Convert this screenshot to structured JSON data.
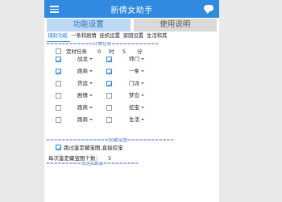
{
  "app": {
    "title": "新倩女助手"
  },
  "main_tabs": [
    {
      "label": "功能设置"
    },
    {
      "label": "使用说明"
    }
  ],
  "sub_tabs": [
    {
      "label": "辅助功能"
    },
    {
      "label": "一条和剧情"
    },
    {
      "label": "挂机设置"
    },
    {
      "label": "家园设置"
    },
    {
      "label": "生活和其"
    }
  ],
  "daily": {
    "header": "============日常任务============",
    "timed_task": {
      "checked": false,
      "label": "定时任务",
      "hour": "0",
      "hour_unit": "时",
      "minute": "5",
      "minute_unit": "分"
    },
    "rows": [
      {
        "left": {
          "checked": true,
          "value": "战龙"
        },
        "right": {
          "checked": true,
          "value": "师门"
        }
      },
      {
        "left": {
          "checked": true,
          "value": "跑商"
        },
        "right": {
          "checked": true,
          "value": "一条"
        }
      },
      {
        "left": {
          "checked": false,
          "value": "货运"
        },
        "right": {
          "checked": true,
          "value": "门派"
        }
      },
      {
        "left": {
          "checked": false,
          "value": "剧情"
        },
        "right": {
          "checked": false,
          "value": "梦岛"
        }
      },
      {
        "left": {
          "checked": false,
          "value": "跑商"
        },
        "right": {
          "checked": false,
          "value": "挖宝"
        }
      },
      {
        "left": {
          "checked": false,
          "value": "跑商"
        },
        "right": {
          "checked": false,
          "value": "生活"
        }
      }
    ]
  },
  "treasure": {
    "header": "================挖藏宝图============",
    "skip_label": "跳过鉴定藏宝图,直接挖宝",
    "skip_checked": true,
    "per_count_label": "每次鉴定藏宝图个数：",
    "per_count_value": "5"
  },
  "trade": {
    "header": "=========货运&跑商========="
  }
}
